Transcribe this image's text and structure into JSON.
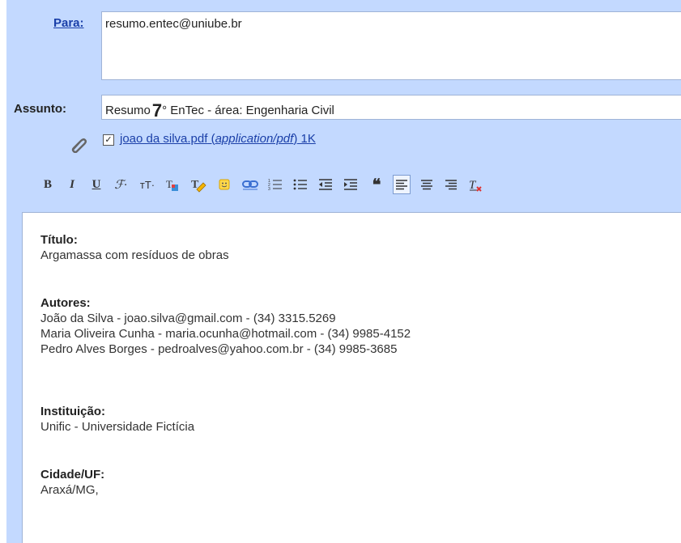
{
  "compose": {
    "to_label": "Para:",
    "to_value": "resumo.entec@uniube.br",
    "subject_label": "Assunto:",
    "subject_prefix": "Resumo",
    "subject_number": "7",
    "subject_rest": "° EnTec - área: Engenharia Civil",
    "attachment": {
      "checked": true,
      "filename": "joao da silva.pdf",
      "open_paren": " (",
      "mimetype": "application/pdf",
      "close_paren": ")",
      "size": " 1K"
    }
  },
  "toolbar": {
    "bold": "B",
    "italic": "I",
    "underline": "U",
    "font": "ℱ·",
    "size": "тT·",
    "quote_glyph": "❝"
  },
  "body": {
    "titulo_label": "Título:",
    "titulo_value": "Argamassa com resíduos de obras",
    "autores_label": "Autores:",
    "autores": [
      "João da Silva - joao.silva@gmail.com - (34) 3315.5269",
      "Maria Oliveira Cunha - maria.ocunha@hotmail.com - (34) 9985-4152",
      "Pedro Alves Borges - pedroalves@yahoo.com.br - (34) 9985-3685"
    ],
    "instituicao_label": "Instituição:",
    "instituicao_value": "Unific - Universidade Fictícia",
    "cidade_label": "Cidade/UF:",
    "cidade_value": "Araxá/MG,"
  },
  "colors": {
    "panel_bg": "#c3d9ff",
    "link": "#1a3fa8"
  },
  "icons": [
    "paperclip-icon",
    "bold-icon",
    "italic-icon",
    "underline-icon",
    "font-icon",
    "font-size-icon",
    "text-color-icon",
    "highlight-icon",
    "emoticon-icon",
    "link-icon",
    "numbered-list-icon",
    "bulleted-list-icon",
    "indent-less-icon",
    "indent-more-icon",
    "quote-icon",
    "align-left-icon",
    "align-center-icon",
    "align-right-icon",
    "remove-formatting-icon"
  ]
}
